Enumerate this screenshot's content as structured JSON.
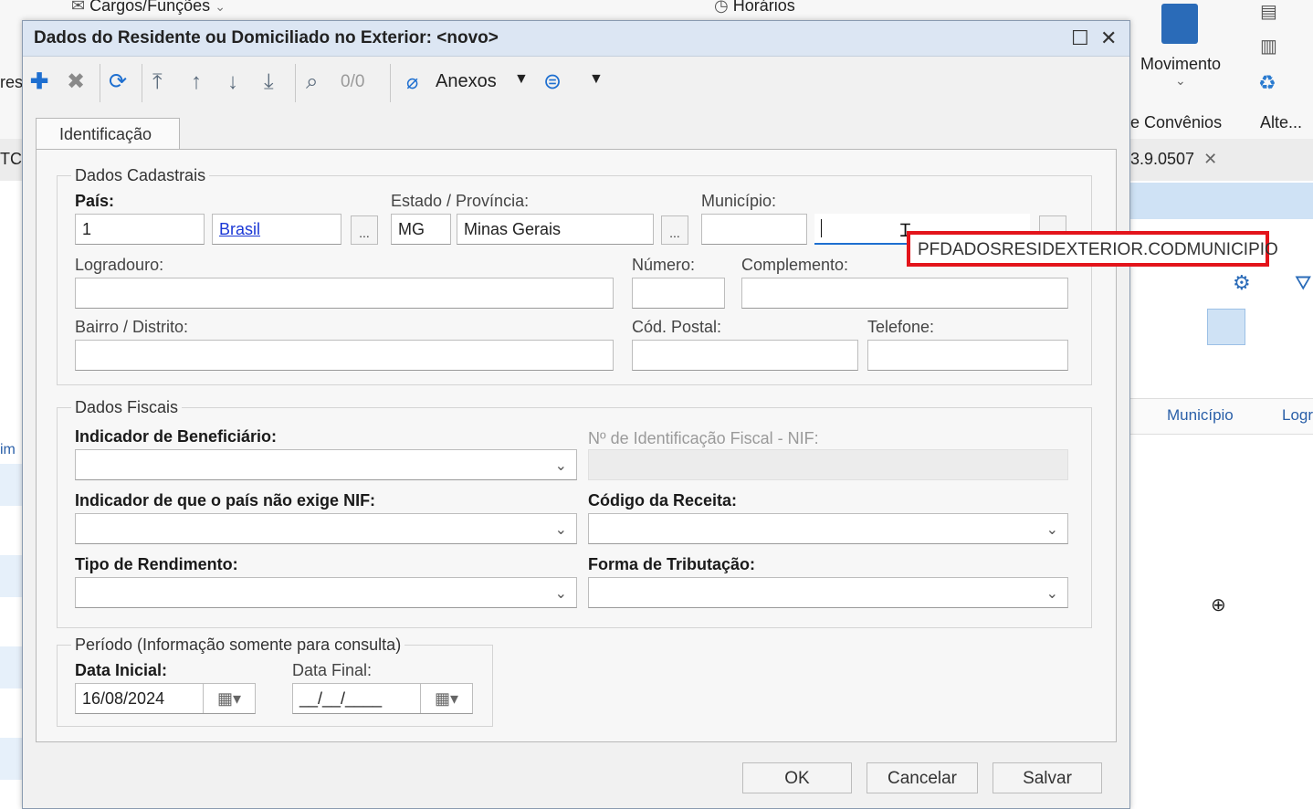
{
  "background": {
    "ribbon_items": [
      "Cargos/Funções",
      "Horários",
      "Movimento",
      "e Convênios",
      "Alte..."
    ],
    "left_fragments": [
      "res",
      "TC",
      "im"
    ],
    "version_tab": "3.9.0507",
    "grid_columns": [
      "Município",
      "Logr"
    ]
  },
  "dialog": {
    "title": "Dados do Residente ou Domiciliado no Exterior: <novo>",
    "toolbar": {
      "record_counter": "0/0",
      "attachments_label": "Anexos"
    },
    "tab_label": "Identificação",
    "dados_cadastrais": {
      "legend": "Dados Cadastrais",
      "pais_label": "País:",
      "pais_code": "1",
      "pais_name": "Brasil",
      "estado_label": "Estado / Província:",
      "estado_code": "MG",
      "estado_name": "Minas Gerais",
      "municipio_label": "Município:",
      "municipio_code": "",
      "municipio_name": "",
      "tooltip": "PFDADOSRESIDEXTERIOR.CODMUNICIPIO",
      "logradouro_label": "Logradouro:",
      "numero_label": "Número:",
      "complemento_label": "Complemento:",
      "bairro_label": "Bairro / Distrito:",
      "cep_label": "Cód. Postal:",
      "telefone_label": "Telefone:"
    },
    "dados_fiscais": {
      "legend": "Dados Fiscais",
      "indicador_beneficiario_label": "Indicador de Beneficiário:",
      "nif_label": "Nº de Identificação Fiscal - NIF:",
      "indicador_nif_label": "Indicador de que o país não exige NIF:",
      "codigo_receita_label": "Código da Receita:",
      "tipo_rendimento_label": "Tipo de Rendimento:",
      "forma_tributacao_label": "Forma de Tributação:"
    },
    "periodo": {
      "legend": "Período (Informação somente para consulta)",
      "data_inicial_label": "Data Inicial:",
      "data_inicial": "16/08/2024",
      "data_final_label": "Data Final:",
      "data_final": "__/__/____"
    },
    "buttons": {
      "ok": "OK",
      "cancel": "Cancelar",
      "save": "Salvar"
    }
  }
}
